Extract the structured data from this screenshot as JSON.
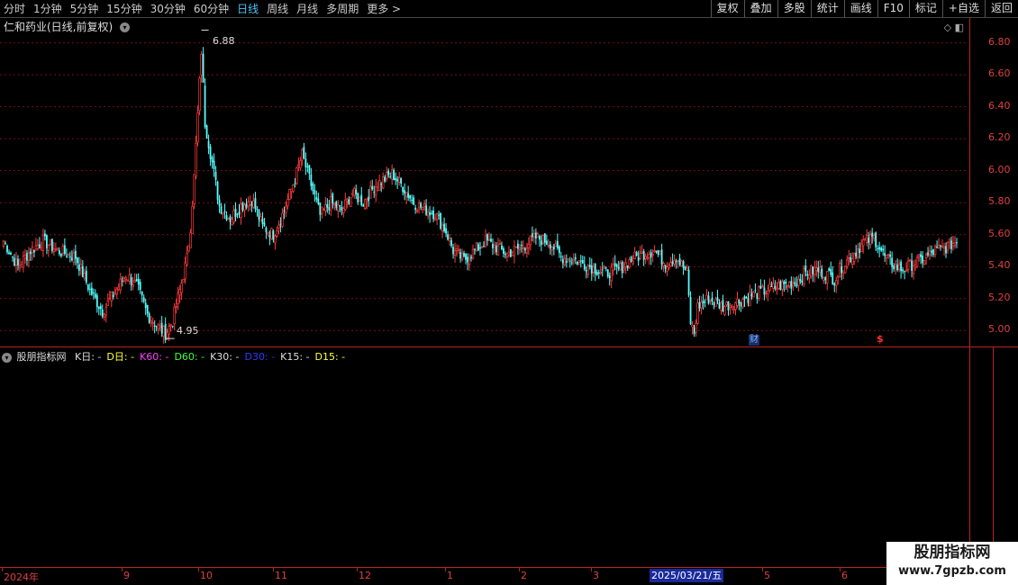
{
  "toolbar": {
    "periods": [
      "分时",
      "1分钟",
      "5分钟",
      "15分钟",
      "30分钟",
      "60分钟",
      "日线",
      "周线",
      "月线",
      "多周期",
      "更多 >"
    ],
    "active_period": "日线",
    "buttons": [
      "复权",
      "叠加",
      "多股",
      "统计",
      "画线",
      "F10",
      "标记",
      "+自选",
      "返回"
    ]
  },
  "stock": {
    "title": "仁和药业(日线,前复权)"
  },
  "price_axis": {
    "labels": [
      "6.80",
      "6.60",
      "6.40",
      "6.20",
      "6.00",
      "5.80",
      "5.60",
      "5.40",
      "5.20",
      "5.00"
    ]
  },
  "extremes": {
    "high": "6.88",
    "low": "4.95"
  },
  "events": {
    "cai": "财",
    "s": "$"
  },
  "indicator": {
    "name": "股朋指标网",
    "items": [
      {
        "label": "K日:",
        "value": "-",
        "color": "#dddddd"
      },
      {
        "label": "D日:",
        "value": "-",
        "color": "#ffff40"
      },
      {
        "label": "K60:",
        "value": "-",
        "color": "#ff40ff"
      },
      {
        "label": "D60:",
        "value": "-",
        "color": "#40ff40"
      },
      {
        "label": "K30:",
        "value": "-",
        "color": "#dddddd"
      },
      {
        "label": "D30:",
        "value": "-",
        "color": "#2b3bff"
      },
      {
        "label": "K15:",
        "value": "-",
        "color": "#dddddd"
      },
      {
        "label": "D15:",
        "value": "-",
        "color": "#ffff40"
      }
    ]
  },
  "date_axis": {
    "labels": [
      "2024年",
      "9",
      "10",
      "11",
      "12",
      "1",
      "2",
      "3",
      "5",
      "6"
    ],
    "current": "2025/03/21/五"
  },
  "watermark": {
    "title": "股朋指标网",
    "url": "www.7gpzb.com"
  },
  "colors": {
    "up": "#ff3a3a",
    "down": "#54ffff",
    "grid": "#7a1010"
  },
  "chart_data": {
    "type": "candlestick",
    "ylim": [
      4.9,
      6.95
    ],
    "y_ticks": [
      5.0,
      5.2,
      5.4,
      5.6,
      5.8,
      6.0,
      6.2,
      6.4,
      6.6,
      6.8
    ],
    "high_marker": 6.88,
    "low_marker": 4.95,
    "anchors": [
      [
        0,
        5.56
      ],
      [
        8,
        5.4
      ],
      [
        15,
        5.5
      ],
      [
        22,
        5.56
      ],
      [
        30,
        5.5
      ],
      [
        40,
        5.46
      ],
      [
        48,
        5.25
      ],
      [
        55,
        5.12
      ],
      [
        62,
        5.24
      ],
      [
        68,
        5.35
      ],
      [
        74,
        5.28
      ],
      [
        80,
        5.1
      ],
      [
        86,
        5.02
      ],
      [
        90,
        4.98
      ],
      [
        94,
        5.06
      ],
      [
        98,
        5.25
      ],
      [
        102,
        5.45
      ],
      [
        104,
        5.65
      ],
      [
        106,
        5.96
      ],
      [
        108,
        6.35
      ],
      [
        110,
        6.75
      ],
      [
        112,
        6.3
      ],
      [
        116,
        6.05
      ],
      [
        120,
        5.78
      ],
      [
        126,
        5.7
      ],
      [
        132,
        5.78
      ],
      [
        138,
        5.82
      ],
      [
        144,
        5.65
      ],
      [
        150,
        5.6
      ],
      [
        156,
        5.75
      ],
      [
        162,
        5.95
      ],
      [
        166,
        6.1
      ],
      [
        170,
        5.95
      ],
      [
        176,
        5.72
      ],
      [
        182,
        5.8
      ],
      [
        188,
        5.75
      ],
      [
        194,
        5.86
      ],
      [
        200,
        5.8
      ],
      [
        206,
        5.9
      ],
      [
        212,
        5.95
      ],
      [
        216,
        5.98
      ],
      [
        222,
        5.9
      ],
      [
        228,
        5.8
      ],
      [
        234,
        5.76
      ],
      [
        240,
        5.73
      ],
      [
        246,
        5.62
      ],
      [
        250,
        5.5
      ],
      [
        256,
        5.44
      ],
      [
        262,
        5.5
      ],
      [
        268,
        5.56
      ],
      [
        274,
        5.52
      ],
      [
        280,
        5.48
      ],
      [
        288,
        5.52
      ],
      [
        296,
        5.58
      ],
      [
        304,
        5.55
      ],
      [
        310,
        5.46
      ],
      [
        318,
        5.44
      ],
      [
        326,
        5.4
      ],
      [
        334,
        5.36
      ],
      [
        342,
        5.38
      ],
      [
        350,
        5.45
      ],
      [
        356,
        5.48
      ],
      [
        362,
        5.5
      ],
      [
        368,
        5.42
      ],
      [
        374,
        5.46
      ],
      [
        380,
        5.36
      ],
      [
        382,
        5.05
      ],
      [
        384,
        4.98
      ],
      [
        386,
        5.15
      ],
      [
        392,
        5.2
      ],
      [
        400,
        5.15
      ],
      [
        408,
        5.18
      ],
      [
        416,
        5.22
      ],
      [
        424,
        5.25
      ],
      [
        432,
        5.28
      ],
      [
        440,
        5.3
      ],
      [
        446,
        5.36
      ],
      [
        452,
        5.38
      ],
      [
        458,
        5.35
      ],
      [
        462,
        5.32
      ],
      [
        466,
        5.4
      ],
      [
        472,
        5.47
      ],
      [
        478,
        5.55
      ],
      [
        484,
        5.58
      ],
      [
        490,
        5.46
      ],
      [
        496,
        5.4
      ],
      [
        500,
        5.38
      ],
      [
        506,
        5.42
      ],
      [
        512,
        5.45
      ],
      [
        518,
        5.5
      ],
      [
        524,
        5.52
      ],
      [
        530,
        5.56
      ]
    ]
  }
}
